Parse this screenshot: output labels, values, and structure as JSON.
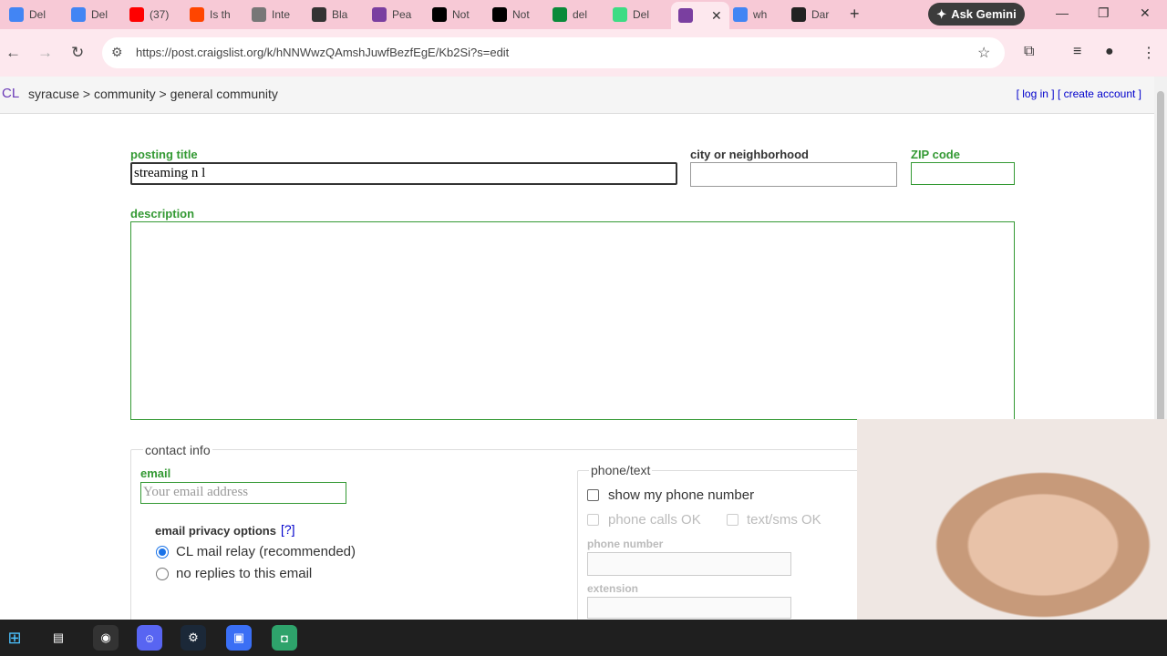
{
  "browser": {
    "tabs": [
      {
        "label": "Del",
        "color": "#4285f4"
      },
      {
        "label": "Del",
        "color": "#4285f4"
      },
      {
        "label": "(37)",
        "color": "#ff0000"
      },
      {
        "label": "Is th",
        "color": "#ff4500"
      },
      {
        "label": "Inte",
        "color": "#777777"
      },
      {
        "label": "Bla",
        "color": "#333333"
      },
      {
        "label": "Pea",
        "color": "#7a3fa0"
      },
      {
        "label": "Not",
        "color": "#000000"
      },
      {
        "label": "Not",
        "color": "#000000"
      },
      {
        "label": "del",
        "color": "#0a8a3a"
      },
      {
        "label": "Del",
        "color": "#3ddc84"
      },
      {
        "label": "",
        "color": "#7a3fa0"
      },
      {
        "label": "wh",
        "color": "#4285f4"
      },
      {
        "label": "Dar",
        "color": "#222222"
      }
    ],
    "new_tab_glyph": "+",
    "ask_gemini": "Ask Gemini",
    "url": "https://post.craigslist.org/k/hNNWwzQAmshJuwfBezfEgE/Kb2Si?s=edit"
  },
  "cl_header": {
    "logo": "CL",
    "breadcrumb": "syracuse > community > general community",
    "log_in": "[ log in ]",
    "create_account": "[ create account ]"
  },
  "form": {
    "posting_title_label": "posting title",
    "posting_title_value": "streaming n l",
    "city_label": "city or neighborhood",
    "city_value": "",
    "zip_label": "ZIP code",
    "zip_value": "",
    "description_label": "description",
    "description_value": ""
  },
  "contact": {
    "legend": "contact info",
    "email_label": "email",
    "email_placeholder": "Your email address",
    "privacy_label": "email privacy options",
    "privacy_help": "[?]",
    "privacy_options": [
      {
        "label": "CL mail relay (recommended)",
        "selected": true
      },
      {
        "label": "no replies to this email",
        "selected": false
      }
    ],
    "phone_legend": "phone/text",
    "show_phone": "show my phone number",
    "phone_calls_ok": "phone calls OK",
    "text_sms_ok": "text/sms OK",
    "phone_number_label": "phone number",
    "extension_label": "extension"
  },
  "taskbar": {
    "items": [
      "windows-start",
      "task-view",
      "chrome",
      "discord",
      "steam",
      "roblox",
      "app"
    ]
  },
  "colors": {
    "tabstrip": "#f7c9d6",
    "label_green": "#339933",
    "link_blue": "#0000cc"
  }
}
